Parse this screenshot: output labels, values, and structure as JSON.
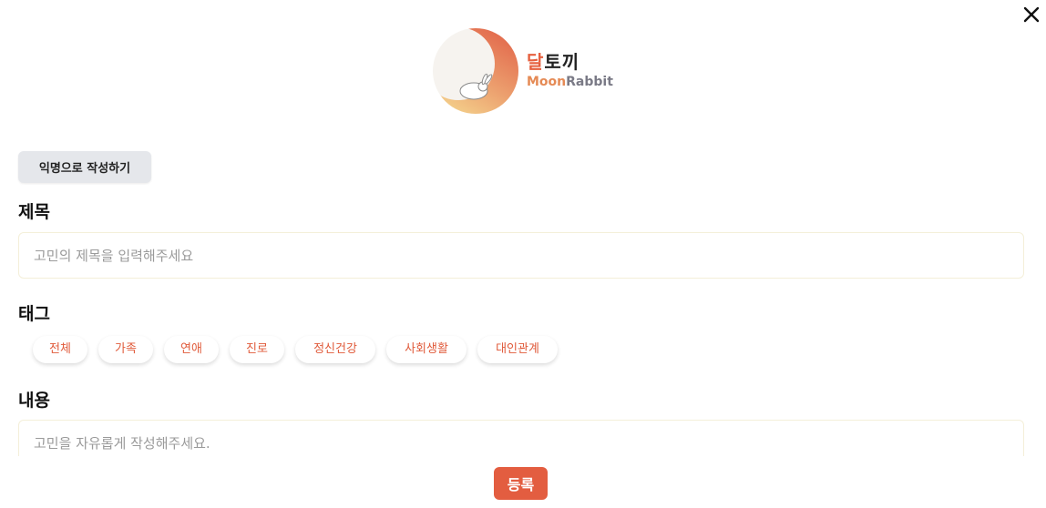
{
  "header": {
    "close_icon": "close-icon",
    "brand_ko_accent": "달",
    "brand_ko_rest": "토끼",
    "brand_en_moon": "Moon",
    "brand_en_rabbit": "Rabbit"
  },
  "form": {
    "anonymous_button": "익명으로 작성하기",
    "title_label": "제목",
    "title_placeholder": "고민의 제목을 입력해주세요",
    "tags_label": "태그",
    "tags": [
      "전체",
      "가족",
      "연애",
      "진로",
      "정신건강",
      "사회생활",
      "대인관계"
    ],
    "content_label": "내용",
    "content_placeholder": "고민을 자유롭게 작성해주세요.",
    "submit_label": "등록"
  },
  "colors": {
    "accent": "#e35d40",
    "tag_text": "#e05a3a",
    "anon_button_bg": "#e5e7eb"
  }
}
